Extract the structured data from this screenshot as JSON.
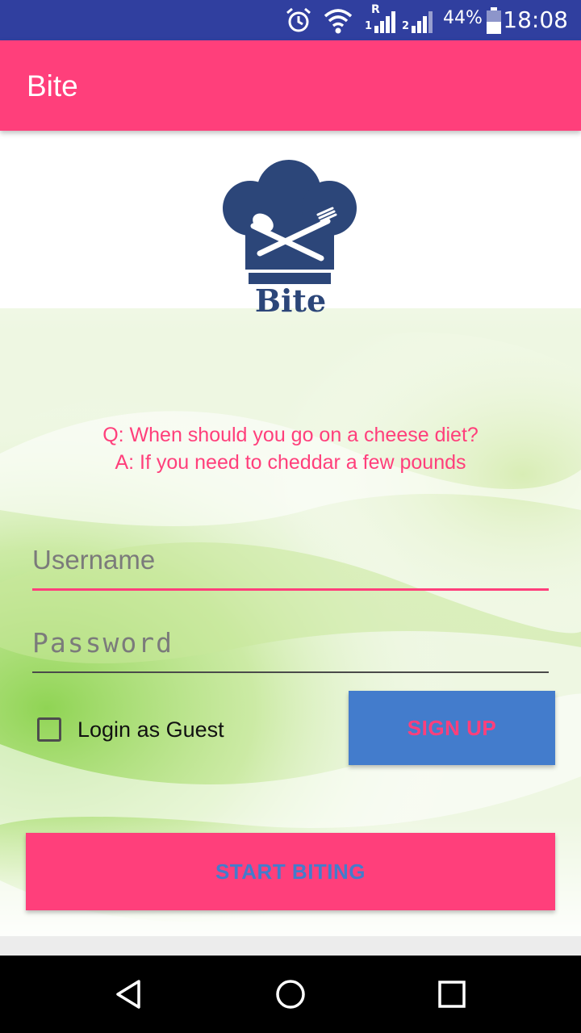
{
  "status_bar": {
    "battery": "44%",
    "time": "18:08",
    "sim1_roaming": "R",
    "sim1_index": "1",
    "sim2_index": "2",
    "icons": [
      "alarm-icon",
      "wifi-icon",
      "signal-icon",
      "signal-icon",
      "battery-icon"
    ]
  },
  "app_bar": {
    "title": "Bite"
  },
  "logo": {
    "text": "Bite"
  },
  "joke": {
    "question": "Q: When should you go on a cheese diet?",
    "answer": "A: If you need to cheddar a few pounds"
  },
  "form": {
    "username_placeholder": "Username",
    "password_placeholder": "Password",
    "guest_label": "Login as Guest",
    "guest_checked": false,
    "signup_label": "SIGN UP",
    "start_label": "START BITING"
  },
  "colors": {
    "status_bar": "#303f9f",
    "primary": "#ff3f7b",
    "signup_button": "#437ccc",
    "logo": "#2c4679"
  },
  "nav": {
    "icons": [
      "back-icon",
      "home-icon",
      "recents-icon"
    ]
  }
}
